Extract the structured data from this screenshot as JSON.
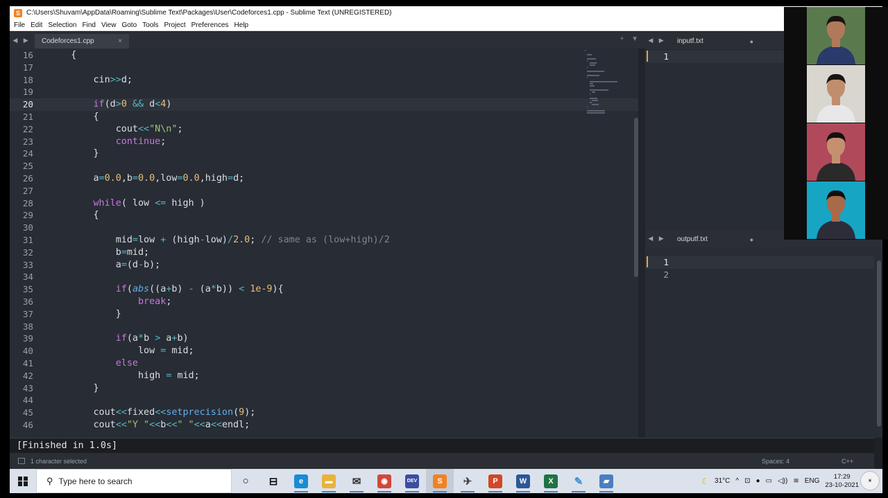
{
  "window": {
    "title": "C:\\Users\\Shuvam\\AppData\\Roaming\\Sublime Text\\Packages\\User\\Codeforces1.cpp - Sublime Text (UNREGISTERED)",
    "app_icon": "sublime-icon"
  },
  "menu": [
    "File",
    "Edit",
    "Selection",
    "Find",
    "View",
    "Goto",
    "Tools",
    "Project",
    "Preferences",
    "Help"
  ],
  "editor": {
    "tab_label": "Codeforces1.cpp",
    "tab_close": "×",
    "tab_tools": "+ ▼",
    "active_line": 20,
    "modified_line": 25,
    "lines": [
      {
        "n": "16",
        "text": "    {"
      },
      {
        "n": "17",
        "text": ""
      },
      {
        "n": "18",
        "text": "        cin>>d;"
      },
      {
        "n": "19",
        "text": ""
      },
      {
        "n": "20",
        "text": "        if(d>0 && d<4)"
      },
      {
        "n": "21",
        "text": "        {"
      },
      {
        "n": "22",
        "text": "            cout<<\"N\\n\";"
      },
      {
        "n": "23",
        "text": "            continue;"
      },
      {
        "n": "24",
        "text": "        }"
      },
      {
        "n": "25",
        "text": ""
      },
      {
        "n": "26",
        "text": "        a=0.0,b=0.0,low=0.0,high=d;"
      },
      {
        "n": "27",
        "text": ""
      },
      {
        "n": "28",
        "text": "        while( low <= high )"
      },
      {
        "n": "29",
        "text": "        {"
      },
      {
        "n": "30",
        "text": ""
      },
      {
        "n": "31",
        "text": "            mid=low + (high-low)/2.0; // same as (low+high)/2"
      },
      {
        "n": "32",
        "text": "            b=mid;"
      },
      {
        "n": "33",
        "text": "            a=(d-b);"
      },
      {
        "n": "34",
        "text": ""
      },
      {
        "n": "35",
        "text": "            if(abs((a+b) - (a*b)) < 1e-9){"
      },
      {
        "n": "36",
        "text": "                break;"
      },
      {
        "n": "37",
        "text": "            }"
      },
      {
        "n": "38",
        "text": ""
      },
      {
        "n": "39",
        "text": "            if(a*b > a+b)"
      },
      {
        "n": "40",
        "text": "                low = mid;"
      },
      {
        "n": "41",
        "text": "            else"
      },
      {
        "n": "42",
        "text": "                high = mid;"
      },
      {
        "n": "43",
        "text": "        }"
      },
      {
        "n": "44",
        "text": ""
      },
      {
        "n": "45",
        "text": "        cout<<fixed<<setprecision(9);"
      },
      {
        "n": "46",
        "text": "        cout<<\"Y \"<<b<<\" \"<<a<<endl;"
      }
    ]
  },
  "input_pane": {
    "tab_label": "inputf.txt",
    "tab_dot": "●",
    "lines": [
      "1"
    ]
  },
  "output_pane": {
    "tab_label": "outputf.txt",
    "tab_dot": "●",
    "lines": [
      "1",
      "2"
    ]
  },
  "build_output": "[Finished in 1.0s]",
  "status": {
    "selection": "1 character selected",
    "spaces": "Spaces: 4",
    "syntax": "C++"
  },
  "taskbar": {
    "search_placeholder": "Type here to search",
    "apps": [
      {
        "name": "task-view-icon",
        "glyph": "○",
        "color": "#111111"
      },
      {
        "name": "widgets-icon",
        "glyph": "⊟",
        "color": "#111111"
      },
      {
        "name": "edge-icon",
        "glyph": "e",
        "color": "#1a8bd6"
      },
      {
        "name": "file-explorer-icon",
        "glyph": "▬",
        "color": "#e8b33a"
      },
      {
        "name": "mail-icon",
        "glyph": "✉",
        "color": "#333333"
      },
      {
        "name": "chrome-icon",
        "glyph": "◉",
        "color": "#d44638"
      },
      {
        "name": "dev-cpp-icon",
        "glyph": "DEV",
        "color": "#3b4ea0"
      },
      {
        "name": "sublime-text-icon",
        "glyph": "S",
        "color": "#f4811f"
      },
      {
        "name": "paper-plane-icon",
        "glyph": "✈",
        "color": "#444444"
      },
      {
        "name": "powerpoint-icon",
        "glyph": "P",
        "color": "#d24726"
      },
      {
        "name": "word-icon",
        "glyph": "W",
        "color": "#2b5797"
      },
      {
        "name": "excel-icon",
        "glyph": "X",
        "color": "#207245"
      },
      {
        "name": "pen-icon",
        "glyph": "✎",
        "color": "#3a8fd8"
      },
      {
        "name": "folder-app-icon",
        "glyph": "▰",
        "color": "#4a7fc0"
      }
    ],
    "weather": "31°C",
    "language": "ENG",
    "time": "17:29",
    "date": "23-10-2021"
  },
  "video_call": {
    "participants": [
      {
        "bg": "#5a7a4e",
        "skin": "#b07a5a",
        "shirt": "#2a3a6a",
        "hair": "#1a1410"
      },
      {
        "bg": "#d9d6d0",
        "skin": "#c08e6c",
        "shirt": "#e8e8e8",
        "hair": "#1a1410"
      },
      {
        "bg": "#b04a5a",
        "skin": "#c59070",
        "shirt": "#2a2a2a",
        "hair": "#151010"
      },
      {
        "bg": "#16a6c4",
        "skin": "#a86a48",
        "shirt": "#2d2d3a",
        "hair": "#101010"
      }
    ]
  },
  "colors": {
    "editor_bg": "#282c34",
    "keyword": "#c678dd",
    "number": "#e5c07b",
    "string": "#98c379",
    "accent": "#f4811f"
  }
}
